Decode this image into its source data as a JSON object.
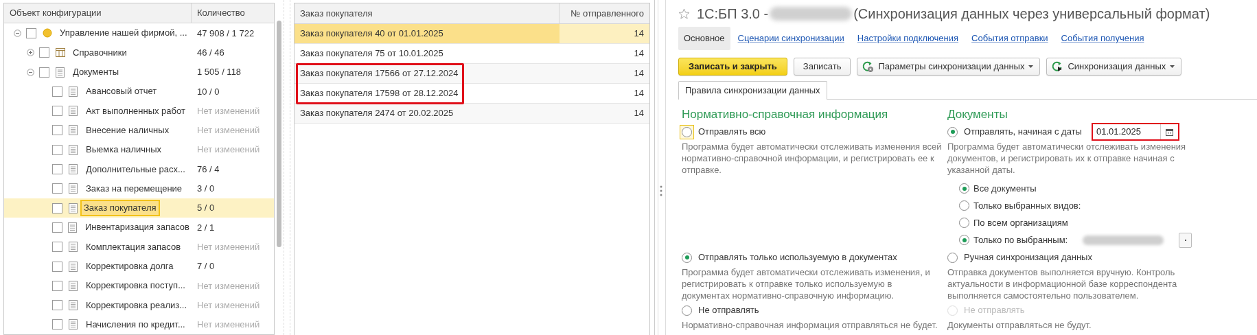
{
  "tree": {
    "columns": [
      "Объект конфигурации",
      "Количество"
    ],
    "items": [
      {
        "kind": "root",
        "label": "Управление нашей фирмой, ...",
        "count": "47 908 / 1 722",
        "dimmed": false,
        "checked": false,
        "selected": false,
        "expanded": true,
        "children": [
          {
            "kind": "catalog",
            "label": "Справочники",
            "count": "46 / 46",
            "dimmed": false,
            "checked": false,
            "selected": false,
            "expanded": false
          },
          {
            "kind": "document",
            "label": "Документы",
            "count": "1 505 / 118",
            "dimmed": false,
            "checked": false,
            "selected": false,
            "expanded": true,
            "children": [
              {
                "kind": "document",
                "label": "Авансовый отчет",
                "count": "10 / 0",
                "dimmed": false,
                "checked": false,
                "selected": false
              },
              {
                "kind": "document",
                "label": "Акт выполненных работ",
                "count": "Нет изменений",
                "dimmed": true,
                "checked": false,
                "selected": false
              },
              {
                "kind": "document",
                "label": "Внесение наличных",
                "count": "Нет изменений",
                "dimmed": true,
                "checked": false,
                "selected": false
              },
              {
                "kind": "document",
                "label": "Выемка наличных",
                "count": "Нет изменений",
                "dimmed": true,
                "checked": false,
                "selected": false
              },
              {
                "kind": "document",
                "label": "Дополнительные расх...",
                "count": "76 / 4",
                "dimmed": false,
                "checked": false,
                "selected": false
              },
              {
                "kind": "document",
                "label": "Заказ на перемещение",
                "count": "3 / 0",
                "dimmed": false,
                "checked": false,
                "selected": false
              },
              {
                "kind": "document",
                "label": "Заказ покупателя",
                "count": "5 / 0",
                "dimmed": false,
                "checked": false,
                "selected": true
              },
              {
                "kind": "document",
                "label": "Инвентаризация запасов",
                "count": "2 / 1",
                "dimmed": false,
                "checked": false,
                "selected": false
              },
              {
                "kind": "document",
                "label": "Комплектация запасов",
                "count": "Нет изменений",
                "dimmed": true,
                "checked": false,
                "selected": false
              },
              {
                "kind": "document",
                "label": "Корректировка долга",
                "count": "7 / 0",
                "dimmed": false,
                "checked": false,
                "selected": false
              },
              {
                "kind": "document",
                "label": "Корректировка поступ...",
                "count": "Нет изменений",
                "dimmed": true,
                "checked": false,
                "selected": false
              },
              {
                "kind": "document",
                "label": "Корректировка реализ...",
                "count": "Нет изменений",
                "dimmed": true,
                "checked": false,
                "selected": false
              },
              {
                "kind": "document",
                "label": "Начисления по кредит...",
                "count": "Нет изменений",
                "dimmed": true,
                "checked": false,
                "selected": false
              }
            ]
          }
        ]
      }
    ]
  },
  "orders": {
    "columns": [
      "Заказ покупателя",
      "№ отправленного"
    ],
    "rows": [
      {
        "order": "Заказ покупателя 40 от 01.01.2025",
        "number": "14",
        "selected": true,
        "marked": false
      },
      {
        "order": "Заказ покупателя 75 от 10.01.2025",
        "number": "14",
        "selected": false,
        "marked": false
      },
      {
        "order": "Заказ покупателя 17566 от 27.12.2024",
        "number": "14",
        "selected": false,
        "marked": true
      },
      {
        "order": "Заказ покупателя 17598 от 28.12.2024",
        "number": "14",
        "selected": false,
        "marked": true
      },
      {
        "order": "Заказ покупателя 2474 от 20.02.2025",
        "number": "14",
        "selected": false,
        "marked": false
      }
    ]
  },
  "form": {
    "title_prefix": "1С:БП 3.0 -",
    "title_suffix": "(Синхронизация данных через универсальный формат)",
    "tabs": [
      {
        "label": "Основное",
        "selected": true
      },
      {
        "label": "Сценарии синхронизации",
        "selected": false
      },
      {
        "label": "Настройки подключения",
        "selected": false
      },
      {
        "label": "События отправки",
        "selected": false
      },
      {
        "label": "События получения",
        "selected": false
      }
    ],
    "buttons": [
      {
        "kind": "primary",
        "label": "Записать и закрыть"
      },
      {
        "kind": "plain",
        "label": "Записать"
      },
      {
        "kind": "params",
        "label": "Параметры синхронизации данных"
      },
      {
        "kind": "sync",
        "label": "Синхронизация данных"
      }
    ],
    "inner_tab": "Правила синхронизации данных",
    "columns": [
      {
        "heading": "Нормативно-справочная информация",
        "options": [
          {
            "label": "Отправлять всю",
            "selected": false,
            "focused": true,
            "disabled": false,
            "description": "Программа будет автоматически отслеживать изменения всей нормативно-справочной информации, и регистрировать ее к отправке."
          },
          {
            "label": "Отправлять только используемую в документах",
            "selected": true,
            "focused": false,
            "disabled": false,
            "description": "Программа будет автоматически отслеживать изменения, и регистрировать к отправке только используемую в документах нормативно-справочную информацию."
          },
          {
            "label": "Не отправлять",
            "selected": false,
            "focused": false,
            "disabled": false,
            "description": "Нормативно-справочная информация отправляться не будет."
          }
        ]
      },
      {
        "heading": "Документы",
        "options": [
          {
            "label": "Отправлять, начиная с даты",
            "selected": true,
            "focused": false,
            "disabled": false,
            "date": {
              "value": "01.01.2025",
              "marked": true
            },
            "description": "Программа будет автоматически отслеживать изменения документов, и регистрировать их к отправке начиная с указанной даты.",
            "suboptions": [
              {
                "label": "Все документы",
                "selected": true,
                "redacted": false
              },
              {
                "label": "Только выбранных видов:",
                "selected": false,
                "redacted": false
              },
              {
                "label": "По всем организациям",
                "selected": false,
                "redacted": false
              },
              {
                "label": "Только по выбранным:",
                "selected": true,
                "redacted": true
              }
            ]
          },
          {
            "label": "Ручная синхронизация данных",
            "selected": false,
            "focused": false,
            "disabled": false,
            "description": "Отправка документов выполняется вручную. Контроль актуальности в информационной базе корреспондента выполняется самостоятельно пользователем."
          },
          {
            "label": "Не отправлять",
            "selected": false,
            "focused": false,
            "disabled": true,
            "description": "Документы отправляться не будут."
          }
        ]
      }
    ]
  }
}
